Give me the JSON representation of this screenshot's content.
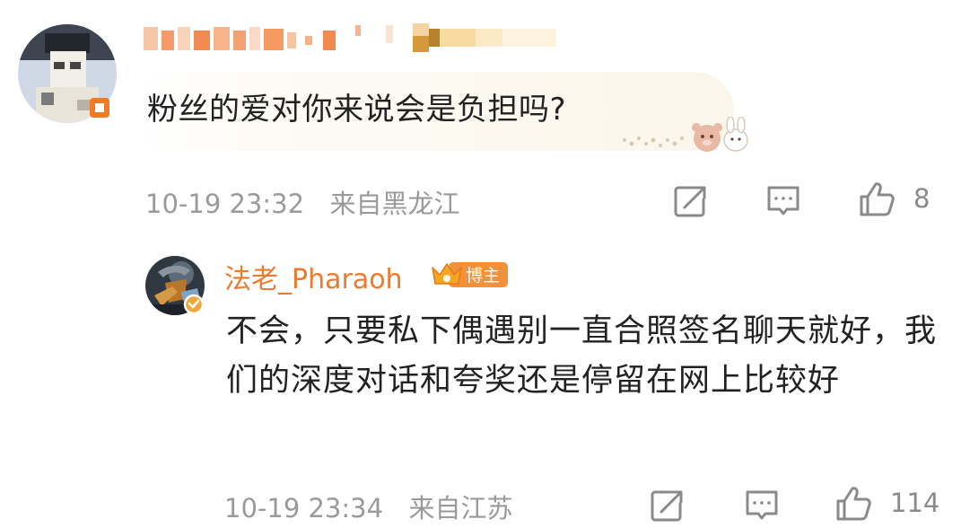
{
  "comment": {
    "text": "粉丝的爱对你来说会是负担吗?",
    "time": "10-19 23:32",
    "location": "来自黑龙江",
    "like_count": "8",
    "icons": [
      "avatar-blurred",
      "share-icon",
      "reply-icon",
      "like-icon",
      "sticker-decoration"
    ]
  },
  "reply": {
    "username": "法老_Pharaoh",
    "badge": "博主",
    "text": "不会，只要私下偶遇别一直合照签名聊天就好，我们的深度对话和夸奖还是停留在网上比较好",
    "time": "10-19 23:34",
    "location": "来自江苏",
    "like_count": "114",
    "icons": [
      "avatar",
      "verified-icon",
      "crown-badge-icon",
      "share-icon",
      "reply-icon",
      "like-icon"
    ]
  },
  "colors": {
    "accent": "#ee7a2e",
    "meta_text": "#9a9a9a",
    "body_text": "#222222"
  }
}
